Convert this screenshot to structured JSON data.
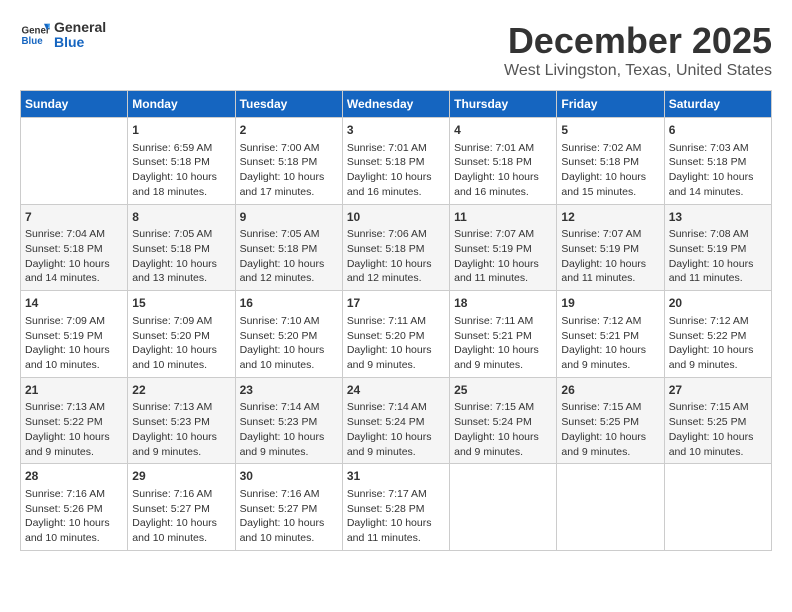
{
  "header": {
    "logo_general": "General",
    "logo_blue": "Blue",
    "month": "December 2025",
    "location": "West Livingston, Texas, United States"
  },
  "calendar": {
    "days_of_week": [
      "Sunday",
      "Monday",
      "Tuesday",
      "Wednesday",
      "Thursday",
      "Friday",
      "Saturday"
    ],
    "weeks": [
      [
        {
          "day": "",
          "sunrise": "",
          "sunset": "",
          "daylight": ""
        },
        {
          "day": "1",
          "sunrise": "Sunrise: 6:59 AM",
          "sunset": "Sunset: 5:18 PM",
          "daylight": "Daylight: 10 hours and 18 minutes."
        },
        {
          "day": "2",
          "sunrise": "Sunrise: 7:00 AM",
          "sunset": "Sunset: 5:18 PM",
          "daylight": "Daylight: 10 hours and 17 minutes."
        },
        {
          "day": "3",
          "sunrise": "Sunrise: 7:01 AM",
          "sunset": "Sunset: 5:18 PM",
          "daylight": "Daylight: 10 hours and 16 minutes."
        },
        {
          "day": "4",
          "sunrise": "Sunrise: 7:01 AM",
          "sunset": "Sunset: 5:18 PM",
          "daylight": "Daylight: 10 hours and 16 minutes."
        },
        {
          "day": "5",
          "sunrise": "Sunrise: 7:02 AM",
          "sunset": "Sunset: 5:18 PM",
          "daylight": "Daylight: 10 hours and 15 minutes."
        },
        {
          "day": "6",
          "sunrise": "Sunrise: 7:03 AM",
          "sunset": "Sunset: 5:18 PM",
          "daylight": "Daylight: 10 hours and 14 minutes."
        }
      ],
      [
        {
          "day": "7",
          "sunrise": "Sunrise: 7:04 AM",
          "sunset": "Sunset: 5:18 PM",
          "daylight": "Daylight: 10 hours and 14 minutes."
        },
        {
          "day": "8",
          "sunrise": "Sunrise: 7:05 AM",
          "sunset": "Sunset: 5:18 PM",
          "daylight": "Daylight: 10 hours and 13 minutes."
        },
        {
          "day": "9",
          "sunrise": "Sunrise: 7:05 AM",
          "sunset": "Sunset: 5:18 PM",
          "daylight": "Daylight: 10 hours and 12 minutes."
        },
        {
          "day": "10",
          "sunrise": "Sunrise: 7:06 AM",
          "sunset": "Sunset: 5:18 PM",
          "daylight": "Daylight: 10 hours and 12 minutes."
        },
        {
          "day": "11",
          "sunrise": "Sunrise: 7:07 AM",
          "sunset": "Sunset: 5:19 PM",
          "daylight": "Daylight: 10 hours and 11 minutes."
        },
        {
          "day": "12",
          "sunrise": "Sunrise: 7:07 AM",
          "sunset": "Sunset: 5:19 PM",
          "daylight": "Daylight: 10 hours and 11 minutes."
        },
        {
          "day": "13",
          "sunrise": "Sunrise: 7:08 AM",
          "sunset": "Sunset: 5:19 PM",
          "daylight": "Daylight: 10 hours and 11 minutes."
        }
      ],
      [
        {
          "day": "14",
          "sunrise": "Sunrise: 7:09 AM",
          "sunset": "Sunset: 5:19 PM",
          "daylight": "Daylight: 10 hours and 10 minutes."
        },
        {
          "day": "15",
          "sunrise": "Sunrise: 7:09 AM",
          "sunset": "Sunset: 5:20 PM",
          "daylight": "Daylight: 10 hours and 10 minutes."
        },
        {
          "day": "16",
          "sunrise": "Sunrise: 7:10 AM",
          "sunset": "Sunset: 5:20 PM",
          "daylight": "Daylight: 10 hours and 10 minutes."
        },
        {
          "day": "17",
          "sunrise": "Sunrise: 7:11 AM",
          "sunset": "Sunset: 5:20 PM",
          "daylight": "Daylight: 10 hours and 9 minutes."
        },
        {
          "day": "18",
          "sunrise": "Sunrise: 7:11 AM",
          "sunset": "Sunset: 5:21 PM",
          "daylight": "Daylight: 10 hours and 9 minutes."
        },
        {
          "day": "19",
          "sunrise": "Sunrise: 7:12 AM",
          "sunset": "Sunset: 5:21 PM",
          "daylight": "Daylight: 10 hours and 9 minutes."
        },
        {
          "day": "20",
          "sunrise": "Sunrise: 7:12 AM",
          "sunset": "Sunset: 5:22 PM",
          "daylight": "Daylight: 10 hours and 9 minutes."
        }
      ],
      [
        {
          "day": "21",
          "sunrise": "Sunrise: 7:13 AM",
          "sunset": "Sunset: 5:22 PM",
          "daylight": "Daylight: 10 hours and 9 minutes."
        },
        {
          "day": "22",
          "sunrise": "Sunrise: 7:13 AM",
          "sunset": "Sunset: 5:23 PM",
          "daylight": "Daylight: 10 hours and 9 minutes."
        },
        {
          "day": "23",
          "sunrise": "Sunrise: 7:14 AM",
          "sunset": "Sunset: 5:23 PM",
          "daylight": "Daylight: 10 hours and 9 minutes."
        },
        {
          "day": "24",
          "sunrise": "Sunrise: 7:14 AM",
          "sunset": "Sunset: 5:24 PM",
          "daylight": "Daylight: 10 hours and 9 minutes."
        },
        {
          "day": "25",
          "sunrise": "Sunrise: 7:15 AM",
          "sunset": "Sunset: 5:24 PM",
          "daylight": "Daylight: 10 hours and 9 minutes."
        },
        {
          "day": "26",
          "sunrise": "Sunrise: 7:15 AM",
          "sunset": "Sunset: 5:25 PM",
          "daylight": "Daylight: 10 hours and 9 minutes."
        },
        {
          "day": "27",
          "sunrise": "Sunrise: 7:15 AM",
          "sunset": "Sunset: 5:25 PM",
          "daylight": "Daylight: 10 hours and 10 minutes."
        }
      ],
      [
        {
          "day": "28",
          "sunrise": "Sunrise: 7:16 AM",
          "sunset": "Sunset: 5:26 PM",
          "daylight": "Daylight: 10 hours and 10 minutes."
        },
        {
          "day": "29",
          "sunrise": "Sunrise: 7:16 AM",
          "sunset": "Sunset: 5:27 PM",
          "daylight": "Daylight: 10 hours and 10 minutes."
        },
        {
          "day": "30",
          "sunrise": "Sunrise: 7:16 AM",
          "sunset": "Sunset: 5:27 PM",
          "daylight": "Daylight: 10 hours and 10 minutes."
        },
        {
          "day": "31",
          "sunrise": "Sunrise: 7:17 AM",
          "sunset": "Sunset: 5:28 PM",
          "daylight": "Daylight: 10 hours and 11 minutes."
        },
        {
          "day": "",
          "sunrise": "",
          "sunset": "",
          "daylight": ""
        },
        {
          "day": "",
          "sunrise": "",
          "sunset": "",
          "daylight": ""
        },
        {
          "day": "",
          "sunrise": "",
          "sunset": "",
          "daylight": ""
        }
      ]
    ]
  }
}
